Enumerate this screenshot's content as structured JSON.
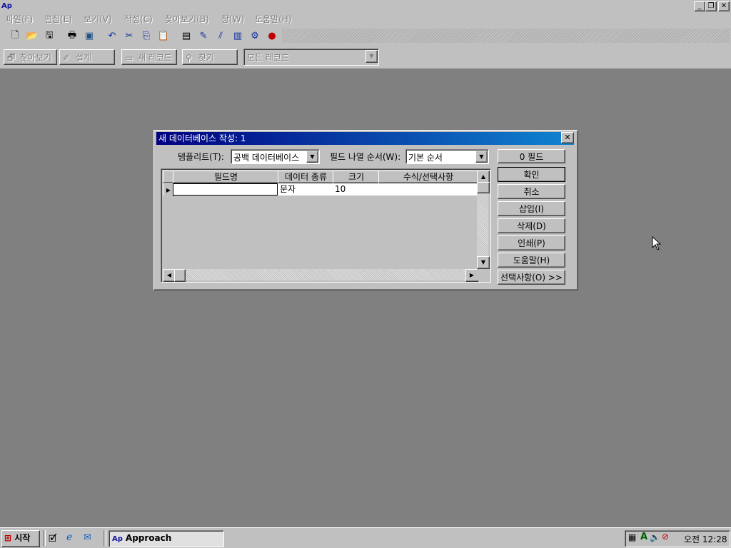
{
  "menu": {
    "items": [
      "파일(F)",
      "편집(E)",
      "보기(V)",
      "작성(C)",
      "찾아보기(B)",
      "창(W)",
      "도움말(H)"
    ]
  },
  "actionbar": {
    "browse": "찾아보기",
    "design": "설계",
    "new_record": "새 레코드",
    "find": "찾기",
    "record_filter": "모든 레코드"
  },
  "dialog": {
    "title": "새 데이터베이스 작성: 1",
    "template_label": "템플리트(T):",
    "template_value": "공백 데이터베이스",
    "order_label": "필드 나열 순서(W):",
    "order_value": "기본 순서",
    "field_count": "0 필드",
    "grid": {
      "headers": [
        "필드명",
        "데이터 종류",
        "크기",
        "수식/선택사항"
      ],
      "row": {
        "name": "",
        "type": "문자",
        "size": "10",
        "formula": ""
      }
    },
    "buttons": {
      "ok": "확인",
      "cancel": "취소",
      "insert": "삽입(I)",
      "delete": "삭제(D)",
      "print": "인쇄(P)",
      "help": "도움말(H)",
      "options": "선택사항(O) >>"
    }
  },
  "taskbar": {
    "start": "시작",
    "task": "Approach",
    "clock": "오전 12:28"
  },
  "colors": {
    "desktop": "#808080",
    "face": "#c0c0c0",
    "title_start": "#000080",
    "title_end": "#1084d0"
  }
}
